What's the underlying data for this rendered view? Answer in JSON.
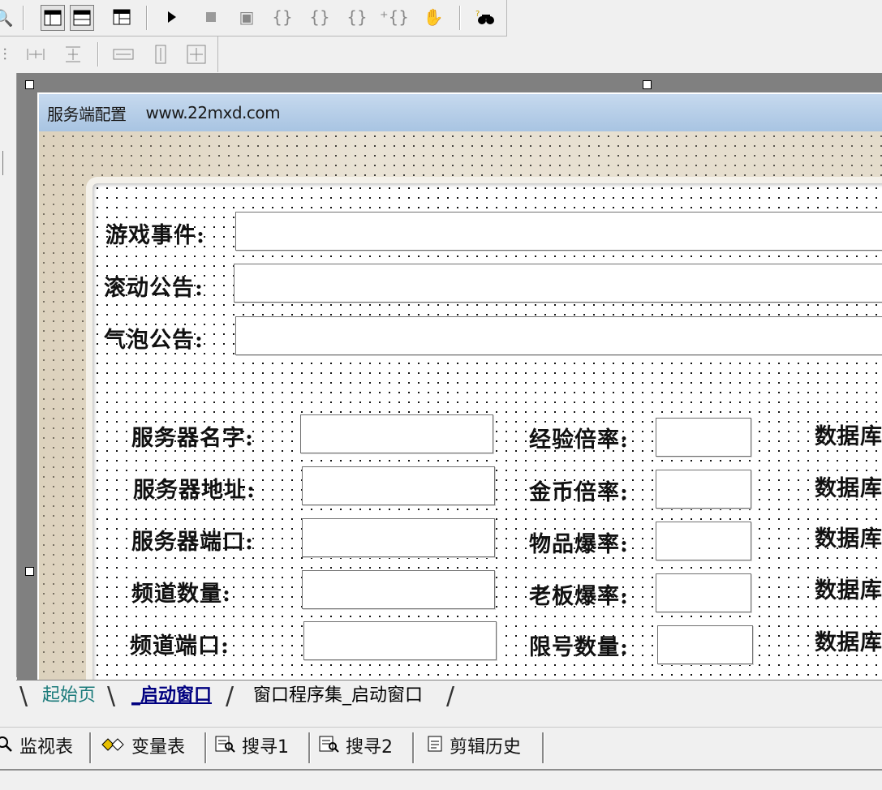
{
  "window": {
    "title": "服务端配置",
    "url": "www.22mxd.com"
  },
  "toolbar1": {
    "icons": [
      "search-icon",
      "layout-columns-icon",
      "layout-rows-icon",
      "layout-grid-icon",
      "run-icon",
      "stop-icon",
      "step-icon",
      "step-in-icon",
      "step-over-icon",
      "step-out-icon",
      "run-to-cursor-icon",
      "hand-icon",
      "find-binoculars-icon"
    ]
  },
  "toolbar2": {
    "icons": [
      "align-icon",
      "space-horizontal-icon",
      "space-vertical-icon",
      "same-width-icon",
      "same-height-icon",
      "same-size-icon"
    ]
  },
  "form": {
    "rows_top": [
      {
        "label": "游戏事件:"
      },
      {
        "label": "滚动公告:"
      },
      {
        "label": "气泡公告:"
      }
    ],
    "col1": [
      {
        "label": "服务器名字:"
      },
      {
        "label": "服务器地址:"
      },
      {
        "label": "服务器端口:"
      },
      {
        "label": "频道数量:"
      },
      {
        "label": "频道端口:"
      }
    ],
    "col2": [
      {
        "label": "经验倍率:"
      },
      {
        "label": "金币倍率:"
      },
      {
        "label": "物品爆率:"
      },
      {
        "label": "老板爆率:"
      },
      {
        "label": "限号数量:"
      }
    ],
    "col3": [
      {
        "label": "数据库"
      },
      {
        "label": "数据库"
      },
      {
        "label": "数据库"
      },
      {
        "label": "数据库"
      },
      {
        "label": "数据库"
      }
    ]
  },
  "tabs": [
    {
      "label": "起始页"
    },
    {
      "label": "_启动窗口"
    },
    {
      "label": "窗口程序集_启动窗口"
    }
  ],
  "bottom_tabs": [
    {
      "label": "监视表",
      "icon": "magnifier-icon"
    },
    {
      "label": "变量表",
      "icon": "variables-icon"
    },
    {
      "label": "搜寻1",
      "icon": "search-results-icon"
    },
    {
      "label": "搜寻2",
      "icon": "search-results-icon"
    },
    {
      "label": "剪辑历史",
      "icon": "clipboard-icon"
    }
  ]
}
